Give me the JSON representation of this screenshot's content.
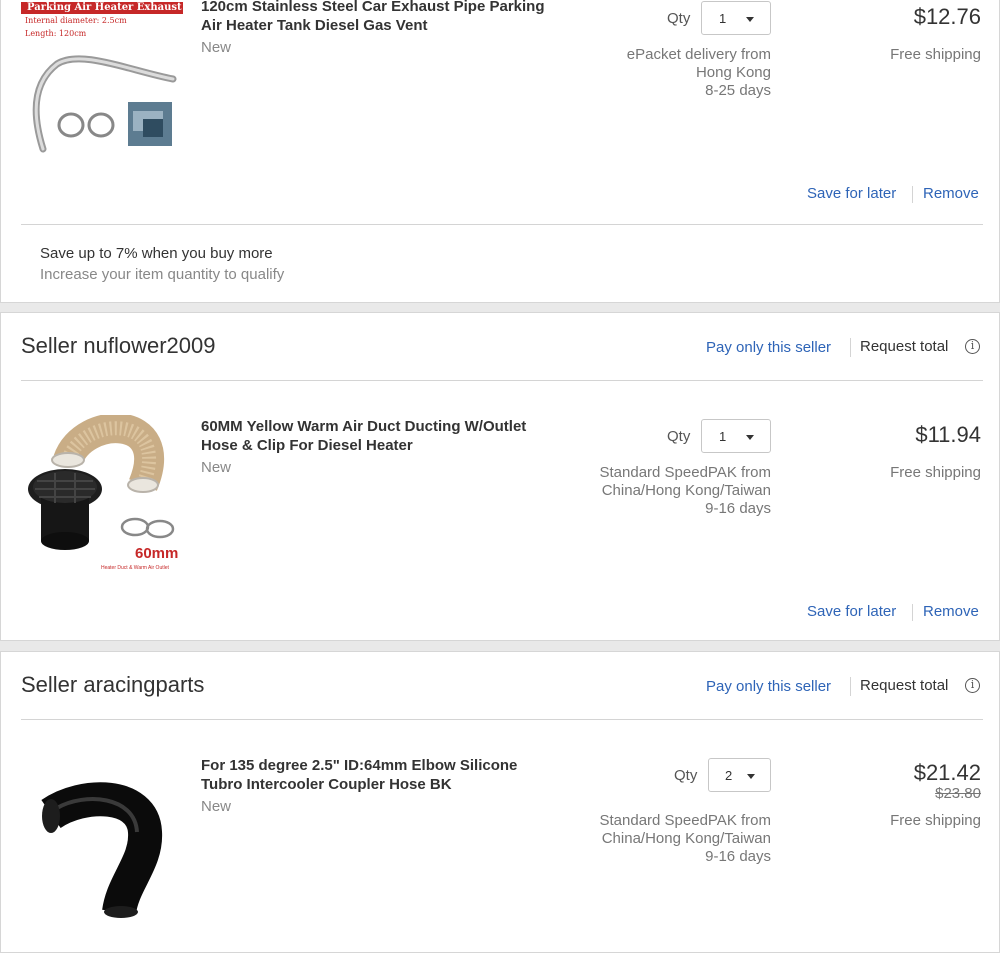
{
  "items": [
    {
      "title": "120cm Stainless Steel Car Exhaust Pipe Parking Air Heater Tank Diesel Gas Vent",
      "condition": "New",
      "qty_label": "Qty",
      "qty": "1",
      "shipping_lines": [
        "ePacket delivery from",
        "Hong Kong",
        "8-25 days"
      ],
      "price": "$12.76",
      "shipping_cost": "Free shipping",
      "save_for_later": "Save for later",
      "remove": "Remove",
      "image_text": [
        "Parking Air Heater Exhaust Pipe",
        "Internal diameter: 2.5cm",
        "Length: 120cm"
      ]
    },
    {
      "title": "60MM Yellow Warm Air Duct Ducting W/Outlet Hose & Clip For Diesel Heater",
      "condition": "New",
      "qty_label": "Qty",
      "qty": "1",
      "shipping_lines": [
        "Standard SpeedPAK from",
        "China/Hong Kong/Taiwan",
        "9-16 days"
      ],
      "price": "$11.94",
      "shipping_cost": "Free shipping",
      "save_for_later": "Save for later",
      "remove": "Remove",
      "image_text": [
        "60mm",
        "Heater Duct & Warm Air Outlet"
      ]
    },
    {
      "title": "For 135 degree 2.5\" ID:64mm Elbow Silicone Tubro Intercooler Coupler Hose BK",
      "condition": "New",
      "qty_label": "Qty",
      "qty": "2",
      "shipping_lines": [
        "Standard SpeedPAK from",
        "China/Hong Kong/Taiwan",
        "9-16 days"
      ],
      "price": "$21.42",
      "original_price": "$23.80",
      "shipping_cost": "Free shipping"
    }
  ],
  "promo": {
    "line1": "Save up to 7% when you buy more",
    "line2": "Increase your item quantity to qualify"
  },
  "sellers": [
    {
      "name": "Seller nuflower2009",
      "pay_only": "Pay only this seller",
      "request_total": "Request total",
      "info_glyph": "i"
    },
    {
      "name": "Seller aracingparts",
      "pay_only": "Pay only this seller",
      "request_total": "Request total",
      "info_glyph": "i"
    }
  ],
  "colors": {
    "link": "#2e64b7",
    "border": "#d6d6d6",
    "background": "#e9e9e9",
    "accent_red": "#c62828"
  },
  "icons": {
    "dropdown": "caret-down-icon",
    "info": "info-circle-icon"
  }
}
